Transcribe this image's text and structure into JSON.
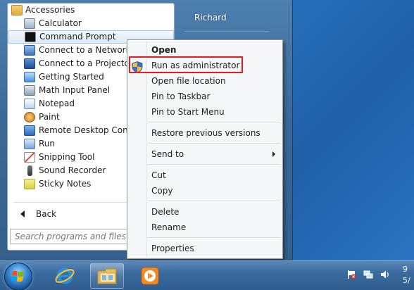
{
  "programs": [
    {
      "label": "Accessories",
      "icon": "folder-icon",
      "color": "#e8b84a"
    },
    {
      "label": "Calculator",
      "icon": "calculator-icon",
      "color": "#6c8fb8"
    },
    {
      "label": "Command Prompt",
      "icon": "command-prompt-icon",
      "color": "#111111"
    },
    {
      "label": "Connect to a Network Projector",
      "icon": "network-projector-icon",
      "color": "#4b7cc6"
    },
    {
      "label": "Connect to a Projector",
      "icon": "projector-icon",
      "color": "#3a6fb5"
    },
    {
      "label": "Getting Started",
      "icon": "getting-started-icon",
      "color": "#5aa0e0"
    },
    {
      "label": "Math Input Panel",
      "icon": "math-input-icon",
      "color": "#7a8fa8"
    },
    {
      "label": "Notepad",
      "icon": "notepad-icon",
      "color": "#8fb6de"
    },
    {
      "label": "Paint",
      "icon": "paint-icon",
      "color": "#e0a24a"
    },
    {
      "label": "Remote Desktop Connection",
      "icon": "remote-desktop-icon",
      "color": "#3f7fd0"
    },
    {
      "label": "Run",
      "icon": "run-icon",
      "color": "#6a9fd8"
    },
    {
      "label": "Snipping Tool",
      "icon": "snipping-tool-icon",
      "color": "#c94040"
    },
    {
      "label": "Sound Recorder",
      "icon": "microphone-icon",
      "color": "#555555"
    },
    {
      "label": "Sticky Notes",
      "icon": "sticky-notes-icon",
      "color": "#e6df6a"
    }
  ],
  "back_label": "Back",
  "search_placeholder": "Search programs and files",
  "user_name": "Richard",
  "context_menu": {
    "items": [
      {
        "label": "Open",
        "bold": true
      },
      {
        "label": "Run as administrator",
        "icon": "uac-shield-icon",
        "highlighted": true
      },
      {
        "label": "Open file location"
      },
      {
        "label": "Pin to Taskbar"
      },
      {
        "label": "Pin to Start Menu"
      },
      {
        "label": "Restore previous versions"
      },
      {
        "label": "Send to",
        "submenu": true
      },
      {
        "label": "Cut"
      },
      {
        "label": "Copy"
      },
      {
        "label": "Delete"
      },
      {
        "label": "Rename"
      },
      {
        "label": "Properties"
      }
    ],
    "highlight_color": "#e11d24"
  },
  "taskbar": {
    "buttons": [
      {
        "name": "internet-explorer",
        "icon": "ie-icon"
      },
      {
        "name": "windows-explorer",
        "icon": "explorer-folder-icon",
        "active": true
      },
      {
        "name": "media-player",
        "icon": "media-player-icon"
      }
    ],
    "clock_line1": "9",
    "clock_line2": "5/"
  }
}
